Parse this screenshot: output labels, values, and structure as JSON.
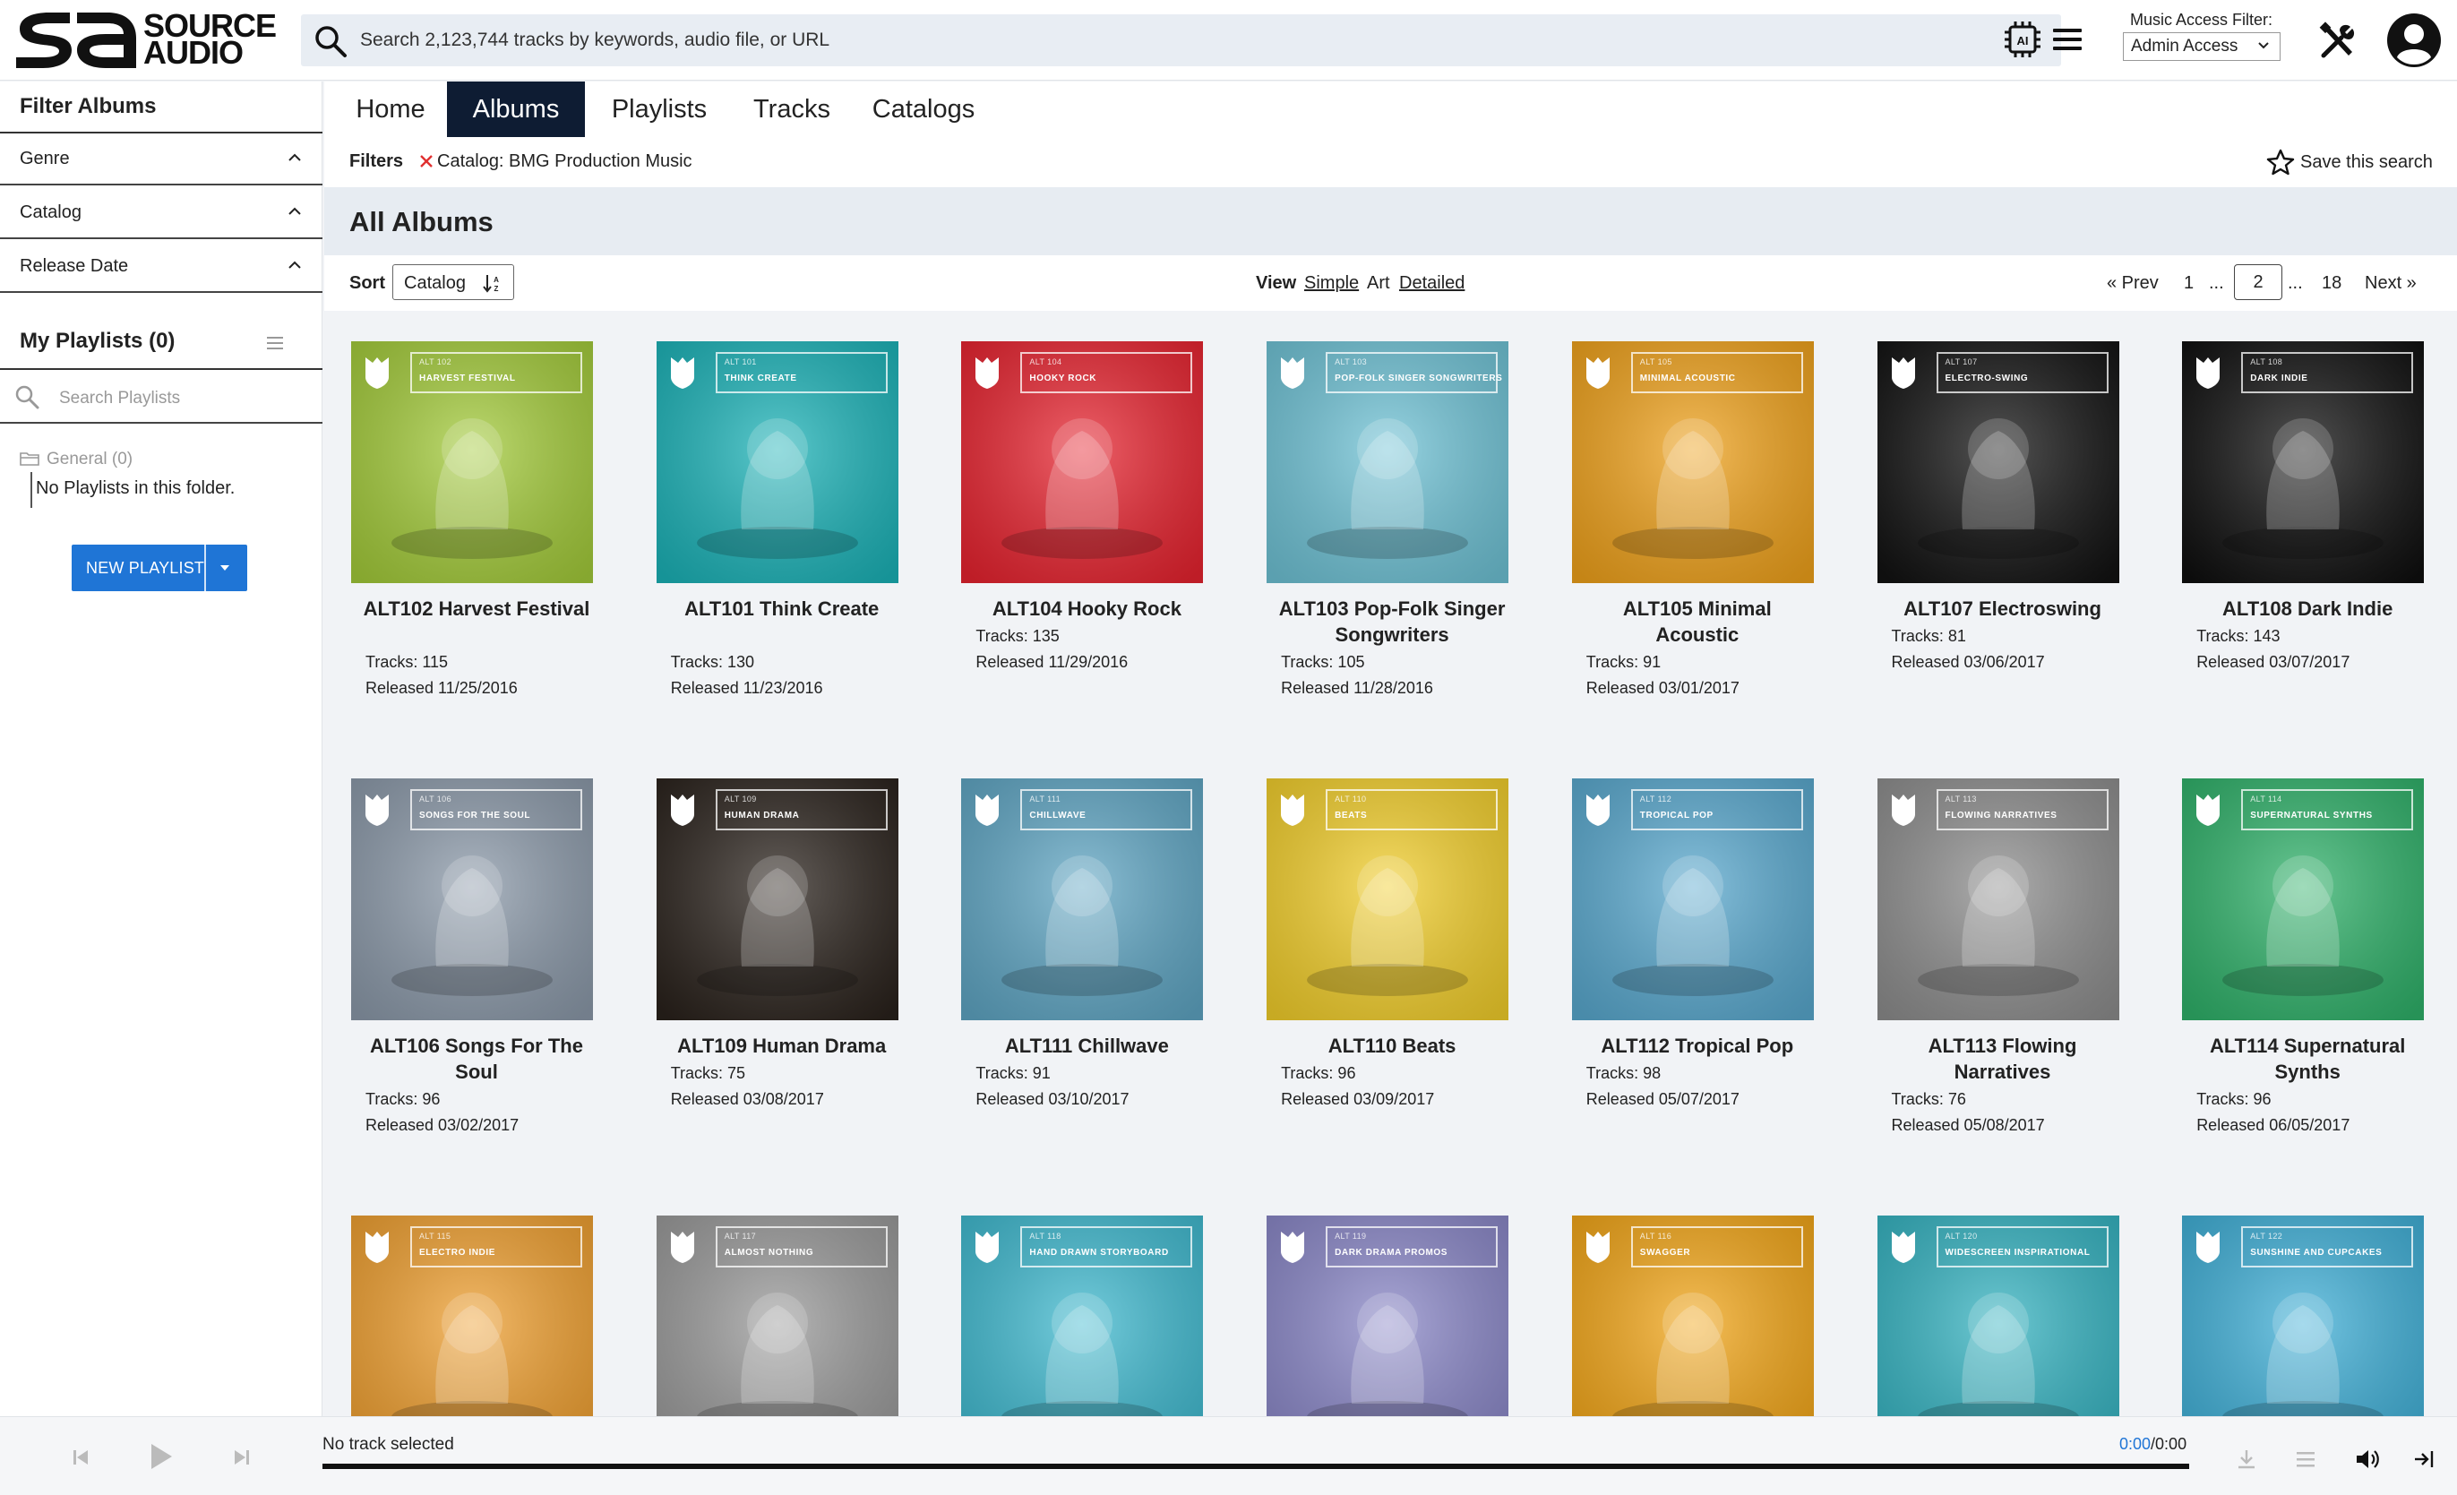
{
  "header": {
    "logo_text_1": "SOURCE",
    "logo_text_2": "AUDIO",
    "search_placeholder": "Search 2,123,744 tracks by keywords, audio file, or URL",
    "music_access_filter_label": "Music Access Filter:",
    "music_access_filter_value": "Admin Access"
  },
  "sidebar": {
    "title": "Filter Albums",
    "filters": [
      {
        "label": "Genre"
      },
      {
        "label": "Catalog"
      },
      {
        "label": "Release Date"
      }
    ],
    "playlists_title": "My Playlists (0)",
    "search_placeholder": "Search Playlists",
    "folder_label": "General (0)",
    "empty_text": "No Playlists in this folder.",
    "new_playlist_label": "NEW PLAYLIST"
  },
  "tabs": [
    {
      "label": "Home",
      "active": false
    },
    {
      "label": "Albums",
      "active": true
    },
    {
      "label": "Playlists",
      "active": false
    },
    {
      "label": "Tracks",
      "active": false
    },
    {
      "label": "Catalogs",
      "active": false
    }
  ],
  "filters": {
    "label": "Filters",
    "chip": "Catalog: BMG Production Music",
    "save_search": "Save this search"
  },
  "section_title": "All Albums",
  "sort": {
    "label": "Sort",
    "value": "Catalog"
  },
  "view": {
    "label": "View",
    "options": [
      "Simple",
      "Art",
      "Detailed"
    ]
  },
  "pagination": {
    "prev": "« Prev",
    "first": "1",
    "ellipsis1": "...",
    "current": "2",
    "ellipsis2": "...",
    "last": "18",
    "next": "Next »"
  },
  "albums": [
    {
      "code": "ALT 102",
      "cover_label": "HARVEST FESTIVAL",
      "name": "ALT102 Harvest Festival",
      "tracks": "Tracks: 115",
      "released": "Released 11/25/2016",
      "color": "#a4cc3a"
    },
    {
      "code": "ALT 101",
      "cover_label": "THINK CREATE",
      "name": "ALT101 Think Create",
      "tracks": "Tracks: 130",
      "released": "Released 11/23/2016",
      "color": "#1bb3b8"
    },
    {
      "code": "ALT 104",
      "cover_label": "HOOKY ROCK",
      "name": "ALT104 Hooky Rock",
      "tracks": "Tracks: 135",
      "released": "Released 11/29/2016",
      "color": "#e8232f"
    },
    {
      "code": "ALT 103",
      "cover_label": "POP-FOLK SINGER SONGWRITERS",
      "name": "ALT103 Pop-Folk Singer Songwriters",
      "tracks": "Tracks: 105",
      "released": "Released 11/28/2016",
      "color": "#6fc3d6"
    },
    {
      "code": "ALT 105",
      "cover_label": "MINIMAL ACOUSTIC",
      "name": "ALT105 Minimal Acoustic",
      "tracks": "Tracks: 91",
      "released": "Released 03/01/2017",
      "color": "#f0a21b"
    },
    {
      "code": "ALT 107",
      "cover_label": "ELECTRO-SWING",
      "name": "ALT107 Electroswing",
      "tracks": "Tracks: 81",
      "released": "Released 03/06/2017",
      "color": "#121212"
    },
    {
      "code": "ALT 108",
      "cover_label": "DARK INDIE",
      "name": "ALT108 Dark Indie",
      "tracks": "Tracks: 143",
      "released": "Released 03/07/2017",
      "color": "#0f0f0f"
    },
    {
      "code": "ALT 106",
      "cover_label": "SONGS FOR THE SOUL",
      "name": "ALT106 Songs For The Soul",
      "tracks": "Tracks: 96",
      "released": "Released 03/02/2017",
      "color": "#8c9aaa"
    },
    {
      "code": "ALT 109",
      "cover_label": "HUMAN DRAMA",
      "name": "ALT109 Human Drama",
      "tracks": "Tracks: 75",
      "released": "Released 03/08/2017",
      "color": "#2a221c"
    },
    {
      "code": "ALT 111",
      "cover_label": "CHILLWAVE",
      "name": "ALT111 Chillwave",
      "tracks": "Tracks: 91",
      "released": "Released 03/10/2017",
      "color": "#5fa6c4"
    },
    {
      "code": "ALT 110",
      "cover_label": "BEATS",
      "name": "ALT110 Beats",
      "tracks": "Tracks: 96",
      "released": "Released 03/09/2017",
      "color": "#f3cf2b"
    },
    {
      "code": "ALT 112",
      "cover_label": "TROPICAL POP",
      "name": "ALT112 Tropical Pop",
      "tracks": "Tracks: 98",
      "released": "Released 05/07/2017",
      "color": "#59a9cf"
    },
    {
      "code": "ALT 113",
      "cover_label": "FLOWING NARRATIVES",
      "name": "ALT113 Flowing Narratives",
      "tracks": "Tracks: 76",
      "released": "Released 05/08/2017",
      "color": "#8e8e8e"
    },
    {
      "code": "ALT 114",
      "cover_label": "SUPERNATURAL SYNTHS",
      "name": "ALT114 Supernatural Synths",
      "tracks": "Tracks: 96",
      "released": "Released 06/05/2017",
      "color": "#2fb26a"
    },
    {
      "code": "ALT 115",
      "cover_label": "ELECTRO INDIE",
      "name": "",
      "tracks": "",
      "released": "",
      "color": "#f0a030"
    },
    {
      "code": "ALT 117",
      "cover_label": "ALMOST NOTHING",
      "name": "",
      "tracks": "",
      "released": "",
      "color": "#9a9a9a"
    },
    {
      "code": "ALT 118",
      "cover_label": "HAND DRAWN STORYBOARD",
      "name": "",
      "tracks": "",
      "released": "",
      "color": "#3fbad0"
    },
    {
      "code": "ALT 119",
      "cover_label": "DARK DRAMA PROMOS",
      "name": "",
      "tracks": "",
      "released": "",
      "color": "#8a87c8"
    },
    {
      "code": "ALT 116",
      "cover_label": "SWAGGER",
      "name": "",
      "tracks": "",
      "released": "",
      "color": "#f3a617"
    },
    {
      "code": "ALT 120",
      "cover_label": "WIDESCREEN INSPIRATIONAL",
      "name": "",
      "tracks": "",
      "released": "",
      "color": "#35b4c2"
    },
    {
      "code": "ALT 122",
      "cover_label": "SUNSHINE AND CUPCAKES",
      "name": "",
      "tracks": "",
      "released": "",
      "color": "#3fb0d8"
    }
  ],
  "player": {
    "status": "No track selected",
    "time_current": "0:00",
    "time_total": "/0:00"
  }
}
